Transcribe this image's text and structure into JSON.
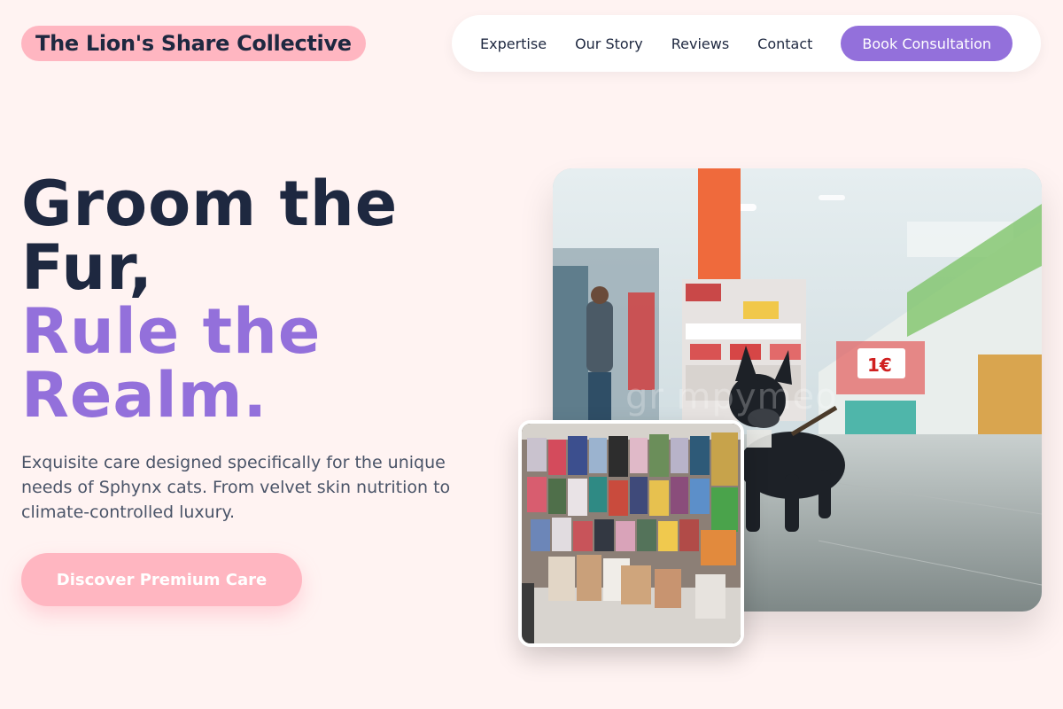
{
  "brand": {
    "name": "The Lion's Share Collective"
  },
  "nav": {
    "links": [
      "Expertise",
      "Our Story",
      "Reviews",
      "Contact"
    ],
    "cta": "Book Consultation"
  },
  "hero": {
    "line1": "Groom the",
    "line2": "Fur,",
    "line3": "Rule the",
    "line4": "Realm.",
    "subtitle": "Exquisite care designed specifically for the unique needs of Sphynx cats. From velvet skin nutrition to climate-controlled luxury.",
    "cta": "Discover Premium Care"
  },
  "images": {
    "main_watermark": "gr mpymeo",
    "main_price_tag": "1€"
  },
  "colors": {
    "background": "#fff3f2",
    "brand_pill": "#ffb6c1",
    "accent_purple": "#9370db",
    "heading_dark": "#1e2840"
  }
}
